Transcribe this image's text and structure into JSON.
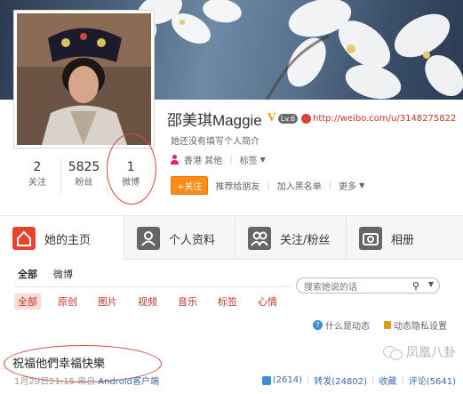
{
  "profile": {
    "name": "邵美琪Maggie",
    "verified_badge": "V",
    "level_badge": "Lv.6",
    "url": "http://weibo.com/u/3148275822",
    "bio": "她还没有填写个人简介",
    "location": "香港 其他",
    "tag_label": "标签",
    "follow_button": "+关注",
    "actions": [
      "推荐给朋友",
      "加入黑名单",
      "更多"
    ],
    "stats": [
      {
        "num": "2",
        "label": "关注"
      },
      {
        "num": "5825",
        "label": "粉丝"
      },
      {
        "num": "1",
        "label": "微博"
      }
    ]
  },
  "tabs": [
    {
      "label": "她的主页",
      "icon": "home-icon"
    },
    {
      "label": "个人资料",
      "icon": "person-icon"
    },
    {
      "label": "关注/粉丝",
      "icon": "people-icon"
    },
    {
      "label": "相册",
      "icon": "camera-icon"
    }
  ],
  "filters": {
    "primary": [
      "全部",
      "微博"
    ],
    "secondary": [
      "全部",
      "原创",
      "图片",
      "视频",
      "音乐",
      "标签",
      "心情"
    ]
  },
  "search": {
    "placeholder": "搜索她说的话"
  },
  "meta": {
    "what_is": "什么是动态",
    "privacy": "动态隐私设置"
  },
  "post": {
    "text": "祝福他們幸福快樂",
    "time": "1月29日21:15",
    "source_prefix": "来自",
    "source": "Android客户端",
    "likes": "(2614)",
    "repost": "转发(24802)",
    "favorite": "收藏",
    "comment": "评论(5641)"
  },
  "watermark": "凤凰八卦",
  "colors": {
    "accent": "#ff8c16",
    "link": "#c0392b",
    "highlight": "#d9463f"
  }
}
